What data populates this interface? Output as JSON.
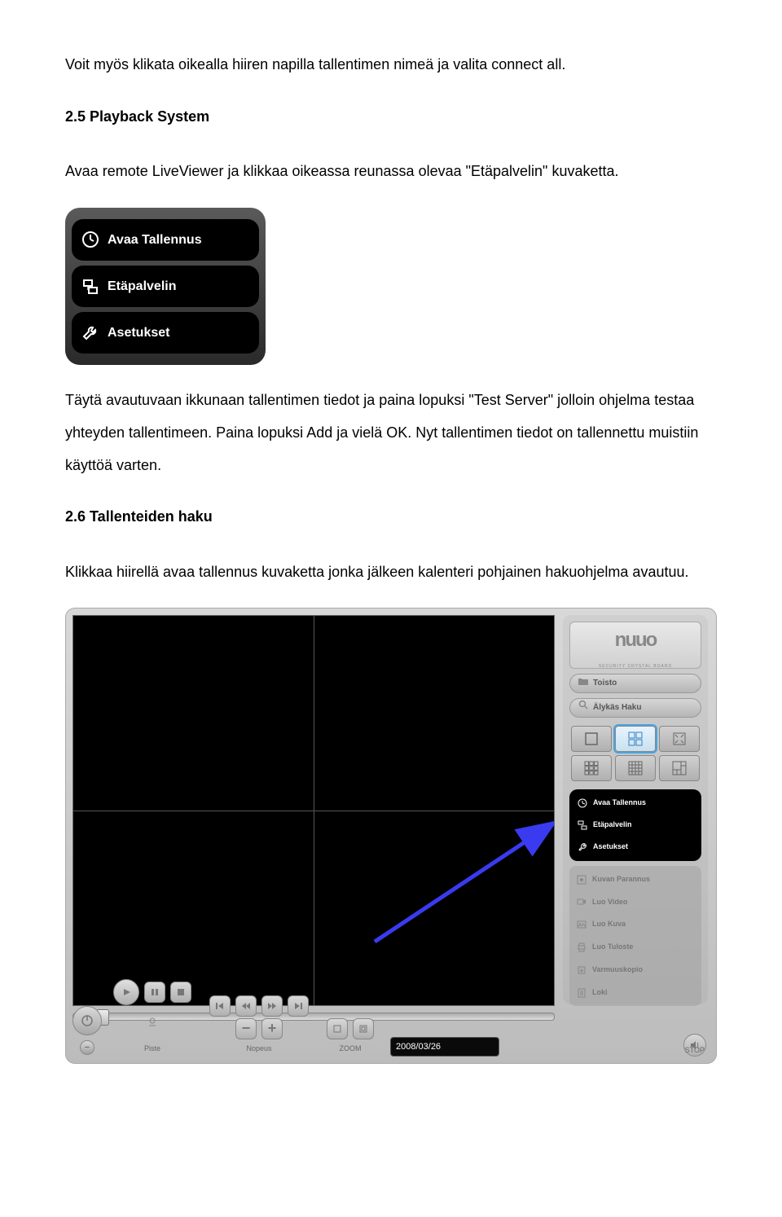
{
  "para1": "Voit myös klikata oikealla hiiren napilla tallentimen nimeä ja valita connect all.",
  "heading1": "2.5 Playback System",
  "para2": "Avaa remote LiveViewer ja klikkaa oikeassa reunassa olevaa \"Etäpalvelin\" kuvaketta.",
  "menu1": {
    "item1": "Avaa Tallennus",
    "item2": "Etäpalvelin",
    "item3": "Asetukset"
  },
  "para3": "Täytä avautuvaan ikkunaan tallentimen tiedot ja paina lopuksi \"Test Server\" jolloin ohjelma testaa yhteyden tallentimeen. Paina lopuksi Add ja vielä OK. Nyt tallentimen tiedot on tallennettu muistiin käyttöä varten.",
  "heading2": "2.6 Tallenteiden haku",
  "para4": "Klikkaa hiirellä avaa tallennus kuvaketta jonka jälkeen kalenteri pohjainen hakuohjelma avautuu.",
  "player": {
    "logo": "nuuo",
    "logo_sub": "SECURITY CRYSTAL BOARD",
    "pill1": "Toisto",
    "pill2": "Älykäs Haku",
    "mini": {
      "m1": "Avaa Tallennus",
      "m2": "Etäpalvelin",
      "m3": "Asetukset"
    },
    "tools": {
      "t1": "Kuvan Parannus",
      "t2": "Luo Video",
      "t3": "Luo Kuva",
      "t4": "Luo Tuloste",
      "t5": "Varmuuskopio",
      "t6": "Loki"
    },
    "date": "2008/03/26",
    "label_piste": "Piste",
    "label_nopeus": "Nopeus",
    "label_zoom": "ZOOM",
    "label_stop": "STOP"
  }
}
